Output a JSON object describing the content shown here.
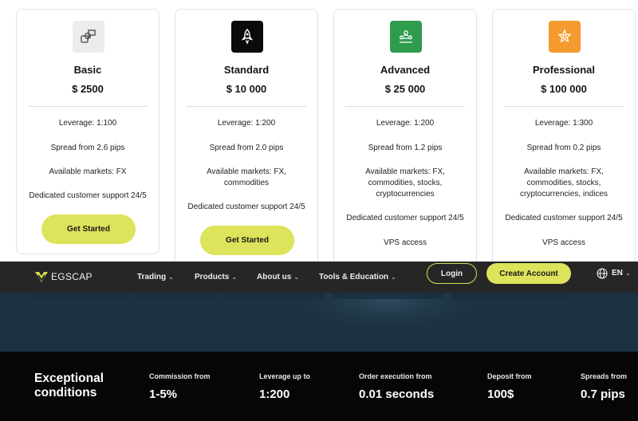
{
  "plans": [
    {
      "icon": "shapes-icon",
      "icon_bg": "#ececec",
      "name": "Basic",
      "price": "$ 2500",
      "features": [
        "Leverage: 1:100",
        "Spread from 2.6 pips",
        "Available markets: FX",
        "Dedicated customer support 24/5"
      ],
      "cta": "Get Started"
    },
    {
      "icon": "rocket-icon",
      "icon_bg": "#0b0b0b",
      "name": "Standard",
      "price": "$ 10 000",
      "features": [
        "Leverage: 1:200",
        "Spread from 2.0 pips",
        "Available markets: FX, commodities",
        "Dedicated customer support 24/5"
      ],
      "cta": "Get Started"
    },
    {
      "icon": "team-icon",
      "icon_bg": "#2f9b4d",
      "name": "Advanced",
      "price": "$ 25 000",
      "features": [
        "Leverage: 1:200",
        "Spread from 1.2 pips",
        "Available markets: FX, commodities, stocks, cryptocurrencies",
        "Dedicated customer support 24/5",
        "VPS access"
      ]
    },
    {
      "icon": "star-badge-icon",
      "icon_bg": "#f59a2e",
      "name": "Professional",
      "price": "$ 100 000",
      "features": [
        "Leverage: 1:300",
        "Spread from 0.2 pips",
        "Available markets: FX, commodities, stocks, cryptocurrencies, indices",
        "Dedicated customer support 24/5",
        "VPS access"
      ]
    }
  ],
  "nav": {
    "logo": "EGSCAP",
    "items": [
      "Trading",
      "Products",
      "About us",
      "Tools & Education"
    ],
    "login": "Login",
    "create_account": "Create Account",
    "language": "EN"
  },
  "conditions": {
    "title": "Exceptional conditions",
    "stats": [
      {
        "label": "Commission from",
        "value": "1-5%"
      },
      {
        "label": "Leverage up to",
        "value": "1:200"
      },
      {
        "label": "Order execution from",
        "value": "0.01 seconds"
      },
      {
        "label": "Deposit from",
        "value": "100$"
      },
      {
        "label": "Spreads from",
        "value": "0.7 pips"
      }
    ]
  },
  "colors": {
    "accent": "#dde35a",
    "nav_bg": "#262626",
    "hero_bg": "#1c3141",
    "conditions_bg": "#060606"
  }
}
